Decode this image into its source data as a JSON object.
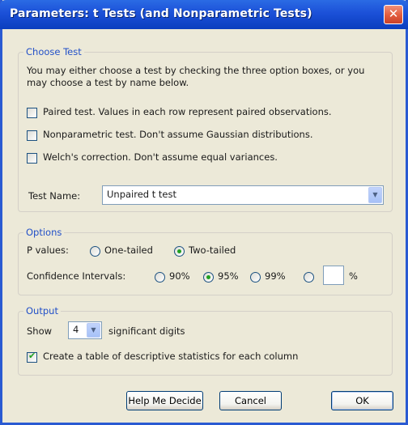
{
  "window": {
    "title": "Parameters: t Tests (and Nonparametric Tests)",
    "close_glyph": "✕"
  },
  "choose_test": {
    "legend": "Choose Test",
    "intro": "You may either choose a test by checking the three option boxes, or you may choose a test by name below.",
    "paired": {
      "label": "Paired test. Values in each row represent paired observations.",
      "checked": false
    },
    "nonparametric": {
      "label": "Nonparametric test. Don't assume Gaussian distributions.",
      "checked": false
    },
    "welch": {
      "label": "Welch's correction. Don't assume equal variances.",
      "checked": false
    },
    "test_name_label": "Test Name:",
    "test_name_value": "Unpaired t test"
  },
  "options": {
    "legend": "Options",
    "p_values_label": "P values:",
    "one_tailed": {
      "label": "One-tailed",
      "checked": false
    },
    "two_tailed": {
      "label": "Two-tailed",
      "checked": true
    },
    "ci_label": "Confidence Intervals:",
    "ci_90": {
      "label": "90%",
      "checked": false
    },
    "ci_95": {
      "label": "95%",
      "checked": true
    },
    "ci_99": {
      "label": "99%",
      "checked": false
    },
    "ci_custom": {
      "checked": false,
      "value": ""
    },
    "percent_sign": "%"
  },
  "output": {
    "legend": "Output",
    "show_label": "Show",
    "digits_value": "4",
    "digits_suffix": "significant digits",
    "descriptive": {
      "label": "Create a table of descriptive statistics for each column",
      "checked": true
    }
  },
  "buttons": {
    "help": "Help Me Decide",
    "cancel": "Cancel",
    "ok": "OK"
  },
  "colors": {
    "title_bar": "#1b50d8",
    "dialog_bg": "#ece9d8",
    "legend_text": "#2250c8",
    "check_mark": "#21a121"
  },
  "icons": {
    "close": "close-icon",
    "dropdown": "chevron-down-icon"
  }
}
